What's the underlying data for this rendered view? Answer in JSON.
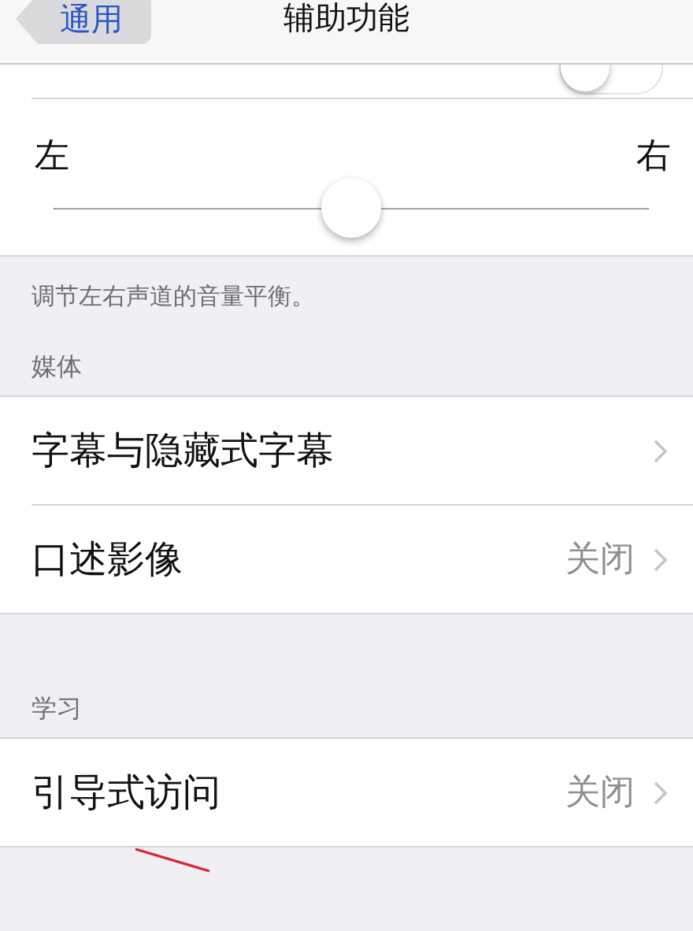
{
  "nav": {
    "back": "通用",
    "title": "辅助功能"
  },
  "toggle_row": {
    "on": false
  },
  "balance": {
    "left": "左",
    "right": "右",
    "level": 0.5
  },
  "balance_note": "调节左右声道的音量平衡。",
  "sections": [
    {
      "header": "媒体",
      "rows": [
        {
          "label": "字幕与隐藏式字幕"
        },
        {
          "label": "口述影像",
          "value": "关闭"
        }
      ]
    },
    {
      "header": "学习",
      "rows": [
        {
          "label": "引导式访问",
          "value": "关闭"
        }
      ]
    }
  ]
}
